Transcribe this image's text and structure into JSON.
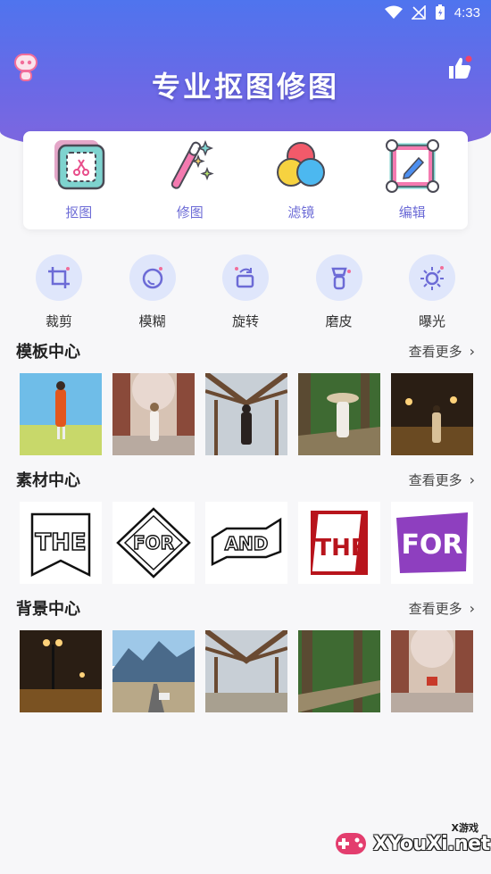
{
  "status_bar": {
    "time": "4:33"
  },
  "header": {
    "title": "专业抠图修图"
  },
  "main_tools": [
    {
      "label": "抠图",
      "icon": "cutout-scissors-icon"
    },
    {
      "label": "修图",
      "icon": "magic-wand-icon"
    },
    {
      "label": "滤镜",
      "icon": "filter-circles-icon"
    },
    {
      "label": "编辑",
      "icon": "edit-frame-icon"
    }
  ],
  "quick_tools": [
    {
      "label": "裁剪",
      "icon": "crop-icon"
    },
    {
      "label": "模糊",
      "icon": "blur-icon"
    },
    {
      "label": "旋转",
      "icon": "rotate-icon"
    },
    {
      "label": "磨皮",
      "icon": "skin-smooth-icon"
    },
    {
      "label": "曝光",
      "icon": "exposure-icon"
    }
  ],
  "sections": {
    "templates": {
      "title": "模板中心",
      "more": "查看更多"
    },
    "materials": {
      "title": "素材中心",
      "more": "查看更多",
      "stickers": [
        "THE",
        "FOR",
        "AND",
        "THE",
        "FOR"
      ]
    },
    "backgrounds": {
      "title": "背景中心",
      "more": "查看更多"
    }
  },
  "watermark": {
    "text": "XYouXi.net",
    "small": "X游戏"
  },
  "colors": {
    "header_top": "#4f74ee",
    "header_bottom": "#8166de",
    "tool_label": "#6c6bd6",
    "mini_circle": "#dfe6fb"
  }
}
